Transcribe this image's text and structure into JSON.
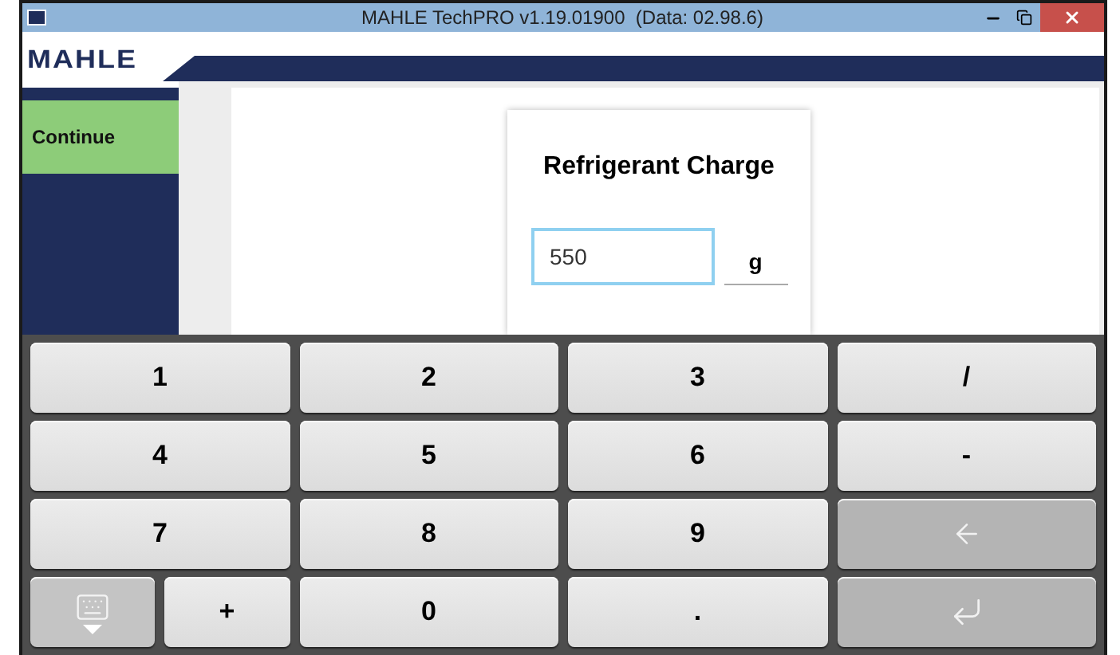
{
  "window": {
    "title": "MAHLE TechPRO v1.19.01900  (Data: 02.98.6)"
  },
  "logo": "MAHLE",
  "sidebar": {
    "buttons": [
      {
        "label": "Continue"
      }
    ]
  },
  "card": {
    "title": "Refrigerant Charge",
    "field": {
      "value": "550",
      "unit": "g"
    }
  },
  "keyboard": {
    "rows": [
      [
        {
          "kind": "key",
          "label": "1"
        },
        {
          "kind": "key",
          "label": "2"
        },
        {
          "kind": "key",
          "label": "3"
        },
        {
          "kind": "key",
          "label": "/"
        }
      ],
      [
        {
          "kind": "key",
          "label": "4"
        },
        {
          "kind": "key",
          "label": "5"
        },
        {
          "kind": "key",
          "label": "6"
        },
        {
          "kind": "key",
          "label": "-"
        }
      ],
      [
        {
          "kind": "key",
          "label": "7"
        },
        {
          "kind": "key",
          "label": "8"
        },
        {
          "kind": "key",
          "label": "9"
        },
        {
          "kind": "backspace"
        }
      ],
      [
        {
          "kind": "pair",
          "keys": [
            {
              "kind": "toggle"
            },
            {
              "kind": "key",
              "label": "+"
            }
          ]
        },
        {
          "kind": "key",
          "label": "0"
        },
        {
          "kind": "key",
          "label": "."
        },
        {
          "kind": "enter"
        }
      ]
    ]
  }
}
